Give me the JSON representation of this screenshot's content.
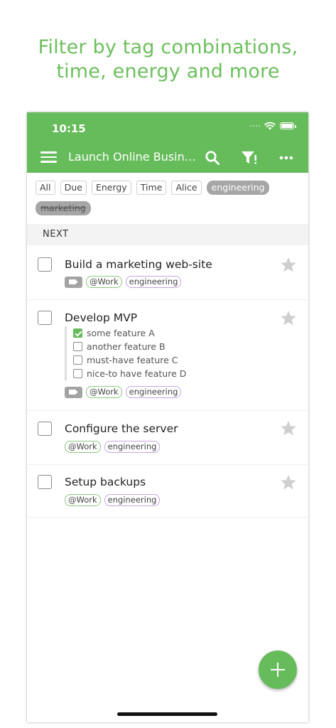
{
  "headline": [
    "Filter by tag combinations,",
    "time, energy and more"
  ],
  "status": {
    "time": "10:15"
  },
  "toolbar": {
    "title": "Launch Online Busin…",
    "icons": [
      "menu-icon",
      "search-icon",
      "filter-icon",
      "more-icon"
    ]
  },
  "tags": [
    {
      "label": "All",
      "state": "normal"
    },
    {
      "label": "Due",
      "state": "normal"
    },
    {
      "label": "Energy",
      "state": "normal"
    },
    {
      "label": "Time",
      "state": "normal"
    },
    {
      "label": "Alice",
      "state": "normal"
    },
    {
      "label": "engineering",
      "state": "active"
    },
    {
      "label": "marketing",
      "state": "excluded"
    }
  ],
  "section": {
    "label": "NEXT"
  },
  "tasks": [
    {
      "name": "Build a marketing web-site",
      "context": "@Work",
      "tag": "engineering"
    },
    {
      "name": "Develop MVP",
      "context": "@Work",
      "tag": "engineering",
      "checklist": [
        {
          "label": "some feature A",
          "checked": true
        },
        {
          "label": "another feature B",
          "checked": false
        },
        {
          "label": "must-have feature C",
          "checked": false
        },
        {
          "label": "nice-to have feature D",
          "checked": false
        }
      ]
    },
    {
      "name": "Configure the server",
      "context": "@Work",
      "tag": "engineering"
    },
    {
      "name": "Setup backups",
      "context": "@Work",
      "tag": "engineering"
    }
  ],
  "colors": {
    "accent": "#66bb5b",
    "headline": "#6cbf5c",
    "star": "#cfcfcf",
    "tag_active": "#a6a6a6"
  }
}
